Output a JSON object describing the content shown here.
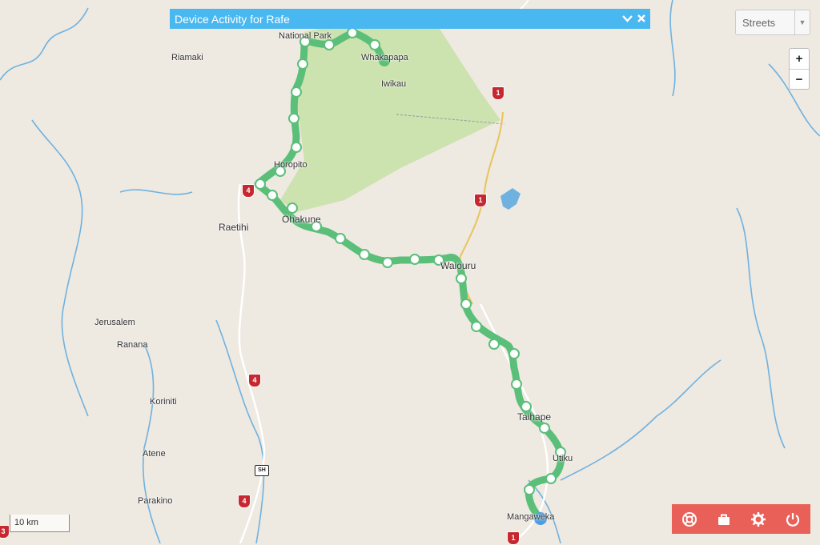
{
  "panel": {
    "title": "Device Activity for Rafe",
    "collapse_icon": "chevron-down-icon",
    "close_icon": "close-icon"
  },
  "layer_select": {
    "value": "Streets"
  },
  "zoom": {
    "in_label": "+",
    "out_label": "−"
  },
  "scale": {
    "label": "10 km"
  },
  "places": {
    "national_park": "National Park",
    "riamaki": "Riamaki",
    "whakapapa": "Whakapapa",
    "iwikau": "Iwikau",
    "horopito": "Horopito",
    "raetihi": "Raetihi",
    "ohakune": "Ohakune",
    "waiouru": "Waiouru",
    "jerusalem": "Jerusalem",
    "ranana": "Ranana",
    "koriniti": "Koriniti",
    "atene": "Atene",
    "parakino": "Parakino",
    "taihape": "Taihape",
    "utiku": "Utiku",
    "mangaweka": "Mangaweka"
  },
  "shields": {
    "s1": "1",
    "s2": "1",
    "s3": "4",
    "s4": "4",
    "s5": "SH",
    "s6": "4",
    "s7": "1",
    "s8": "3"
  },
  "toolbar": {
    "items": [
      {
        "icon": "lifebuoy-icon"
      },
      {
        "icon": "briefcase-icon"
      },
      {
        "icon": "gear-icon"
      },
      {
        "icon": "power-icon"
      }
    ]
  },
  "colors": {
    "route": "#5bbf7a",
    "panel": "#49b8f0",
    "toolbar": "#e86058",
    "park": "#c6e0a6",
    "river": "#6fb2e0",
    "position": "#4a9de0"
  }
}
